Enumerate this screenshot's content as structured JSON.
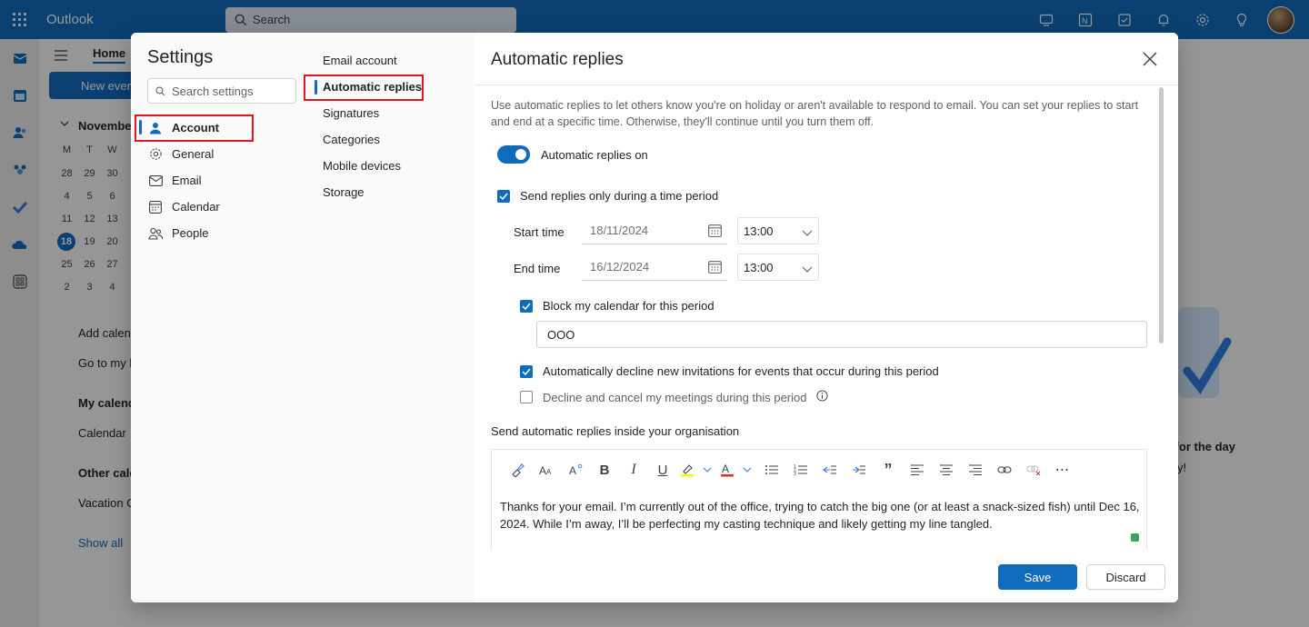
{
  "app": {
    "title": "Outlook"
  },
  "topbar": {
    "search_placeholder": "Search"
  },
  "background": {
    "home_tab": "Home",
    "new_event": "New event",
    "month_label": "November",
    "weekday_headers": [
      "M",
      "T",
      "W"
    ],
    "calendar_rows": [
      [
        "28",
        "29",
        "30"
      ],
      [
        "4",
        "5",
        "6"
      ],
      [
        "11",
        "12",
        "13"
      ],
      [
        "18",
        "19",
        "20"
      ],
      [
        "25",
        "26",
        "27"
      ],
      [
        "2",
        "3",
        "4"
      ]
    ],
    "today": "18",
    "add_calendar": "Add calendar",
    "go_to_my": "Go to my b",
    "my_calendars": "My calend",
    "calendar_item": "Calendar",
    "other_calendars": "Other cale",
    "vacation_item": "Vacation C",
    "show_all": "Show all",
    "right_text_1": "d for the day",
    "right_text_2": "y!"
  },
  "settings": {
    "title": "Settings",
    "search_placeholder": "Search settings",
    "nav": [
      {
        "label": "Account",
        "icon": "person-icon"
      },
      {
        "label": "General",
        "icon": "gear-icon"
      },
      {
        "label": "Email",
        "icon": "mail-icon"
      },
      {
        "label": "Calendar",
        "icon": "calendar-icon"
      },
      {
        "label": "People",
        "icon": "people-icon"
      }
    ],
    "subnav": [
      "Email account",
      "Automatic replies",
      "Signatures",
      "Categories",
      "Mobile devices",
      "Storage"
    ]
  },
  "pane": {
    "title": "Automatic replies",
    "description": "Use automatic replies to let others know you're on holiday or aren't available to respond to email. You can set your replies to start and end at a specific time. Otherwise, they'll continue until you turn them off.",
    "toggle_label": "Automatic replies on",
    "toggle_on": true,
    "time_period_label": "Send replies only during a time period",
    "time_period_checked": true,
    "start_label": "Start time",
    "start_date": "18/11/2024",
    "start_time": "13:00",
    "end_label": "End time",
    "end_date": "16/12/2024",
    "end_time": "13:00",
    "block_calendar_label": "Block my calendar for this period",
    "block_calendar_checked": true,
    "subject_value": "OOO",
    "decline_invites_label": "Automatically decline new invitations for events that occur during this period",
    "decline_invites_checked": true,
    "decline_cancel_label": "Decline and cancel my meetings during this period",
    "decline_cancel_checked": false,
    "inside_org_label": "Send automatic replies inside your organisation",
    "message_body": "Thanks for your email. I’m currently out of the office, trying to catch the big one (or at least a snack-sized fish) until Dec 16, 2024. While I’m away, I’ll be perfecting my casting technique and likely getting my line tangled.",
    "save_label": "Save",
    "discard_label": "Discard"
  },
  "colors": {
    "accent": "#0f6cbd",
    "highlight_box": "#e0151c"
  }
}
